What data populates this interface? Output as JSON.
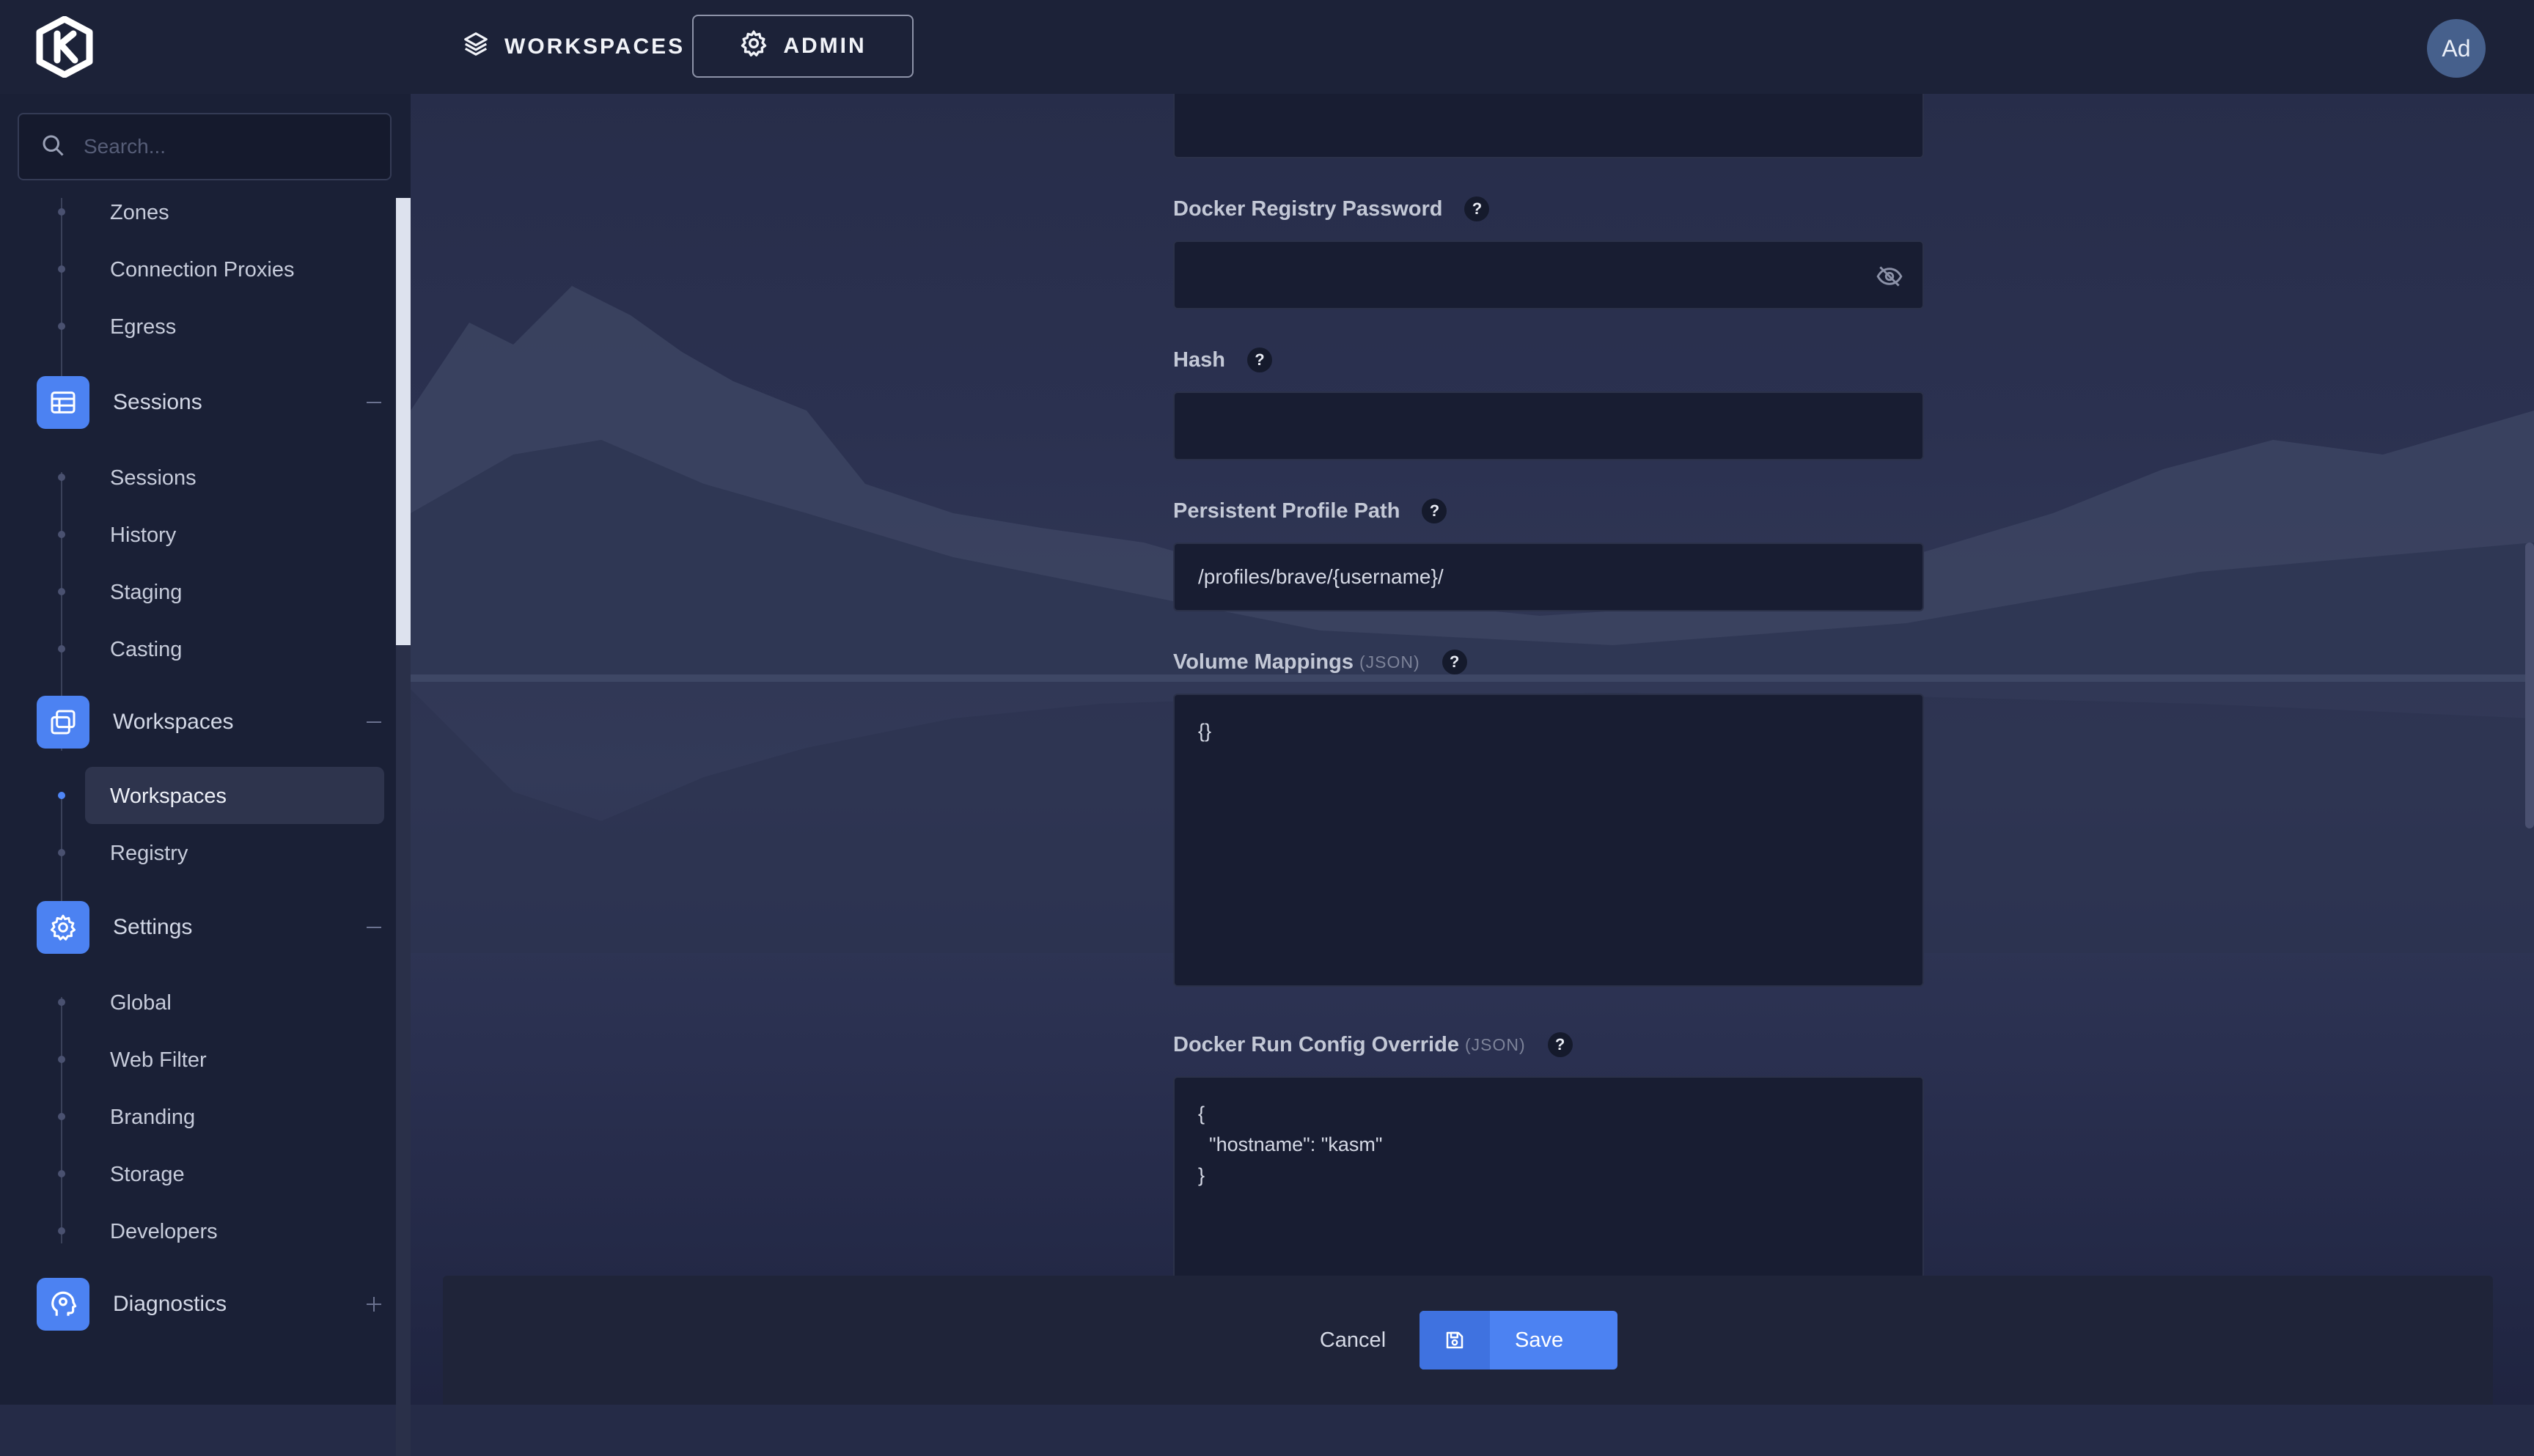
{
  "topbar": {
    "workspaces_label": "WORKSPACES",
    "admin_label": "ADMIN",
    "avatar_initials": "Ad"
  },
  "sidebar": {
    "search_placeholder": "Search...",
    "infra_items": [
      "Zones",
      "Connection Proxies",
      "Egress"
    ],
    "sessions": {
      "label": "Sessions",
      "items": [
        "Sessions",
        "History",
        "Staging",
        "Casting"
      ]
    },
    "workspaces": {
      "label": "Workspaces",
      "items": [
        "Workspaces",
        "Registry"
      ],
      "active_item": "Workspaces"
    },
    "settings": {
      "label": "Settings",
      "items": [
        "Global",
        "Web Filter",
        "Branding",
        "Storage",
        "Developers"
      ]
    },
    "diagnostics": {
      "label": "Diagnostics"
    }
  },
  "form": {
    "docker_registry_password_label": "Docker Registry Password",
    "hash_label": "Hash",
    "persistent_profile_path_label": "Persistent Profile Path",
    "persistent_profile_path_value": "/profiles/brave/{username}/",
    "volume_mappings_label": "Volume Mappings",
    "volume_mappings_tag": "(JSON)",
    "volume_mappings_value": "{}",
    "docker_run_config_label": "Docker Run Config Override",
    "docker_run_config_tag": "(JSON)",
    "docker_run_config_value": "{\n  \"hostname\": \"kasm\"\n}",
    "help_mark": "?"
  },
  "footer": {
    "cancel_label": "Cancel",
    "save_label": "Save"
  },
  "colors": {
    "accent": "#4c82f2",
    "sidebar_bg": "#1a2036",
    "input_bg": "#181d32"
  }
}
